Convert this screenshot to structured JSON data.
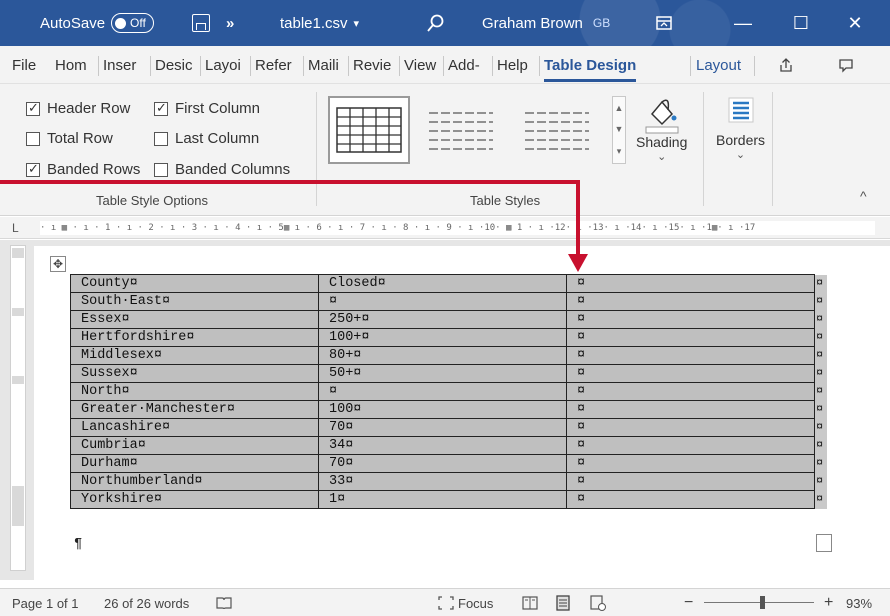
{
  "titlebar": {
    "autosave_label": "AutoSave",
    "autosave_state": "Off",
    "more_glyph": "»",
    "doc_title": "table1.csv",
    "doc_title_caret": "▾",
    "user_name": "Graham Brown",
    "user_initials": "GB",
    "minimize_glyph": "—",
    "restore_glyph": "☐",
    "close_glyph": "✕"
  },
  "tabs": [
    "File",
    "Hom",
    "Inser",
    "Desic",
    "Layoi",
    "Refer",
    "Maili",
    "Revie",
    "View",
    "Add-",
    "Help",
    "Table Design",
    "Layout"
  ],
  "active_tab": "Table Design",
  "ribbon": {
    "table_style_options": {
      "label": "Table Style Options",
      "options": [
        {
          "label": "Header Row",
          "checked": true
        },
        {
          "label": "First Column",
          "checked": true
        },
        {
          "label": "Total Row",
          "checked": false
        },
        {
          "label": "Last Column",
          "checked": false
        },
        {
          "label": "Banded Rows",
          "checked": true
        },
        {
          "label": "Banded Columns",
          "checked": false
        }
      ]
    },
    "table_styles": {
      "label": "Table Styles",
      "shading_label": "Shading",
      "shading_caret": "⌄"
    },
    "borders": {
      "label": "Borders",
      "caret": "⌄"
    },
    "collapse_glyph": "^"
  },
  "ruler": {
    "text": "· ı ▦ · ı · 1 · ı · 2 · ı · 3 · ı · 4 · ı · 5▦ ı · 6 · ı · 7 · ı · 8 · ı · 9 · ı ·10· ▦ 1 · ı ·12· ı ·13· ı ·14· ı ·15· ı ·1▦· ı ·17",
    "tab_glyph": "L"
  },
  "table": {
    "rows": [
      [
        "County¤",
        "Closed¤",
        "¤"
      ],
      [
        "South·East¤",
        "¤",
        "¤"
      ],
      [
        "Essex¤",
        "250+¤",
        "¤"
      ],
      [
        "Hertfordshire¤",
        "100+¤",
        "¤"
      ],
      [
        "Middlesex¤",
        "80+¤",
        "¤"
      ],
      [
        "Sussex¤",
        "50+¤",
        "¤"
      ],
      [
        "North¤",
        "¤",
        "¤"
      ],
      [
        "Greater·Manchester¤",
        "100¤",
        "¤"
      ],
      [
        "Lancashire¤",
        "70¤",
        "¤"
      ],
      [
        "Cumbria¤",
        "34¤",
        "¤"
      ],
      [
        "Durham¤",
        "70¤",
        "¤"
      ],
      [
        "Northumberland¤",
        "33¤",
        "¤"
      ],
      [
        "Yorkshire¤",
        "1¤",
        "¤"
      ]
    ],
    "end_of_row_mark": "¤",
    "paragraph_mark": "¶",
    "move_handle_glyph": "✥"
  },
  "status": {
    "page": "Page 1 of 1",
    "words": "26 of 26 words",
    "focus_label": "Focus",
    "zoom_minus": "−",
    "zoom_plus": "+",
    "zoom_level": "93%"
  },
  "colors": {
    "brand": "#2b579a",
    "arrow": "#c8102e",
    "table_shading": "#bfbfbf"
  }
}
